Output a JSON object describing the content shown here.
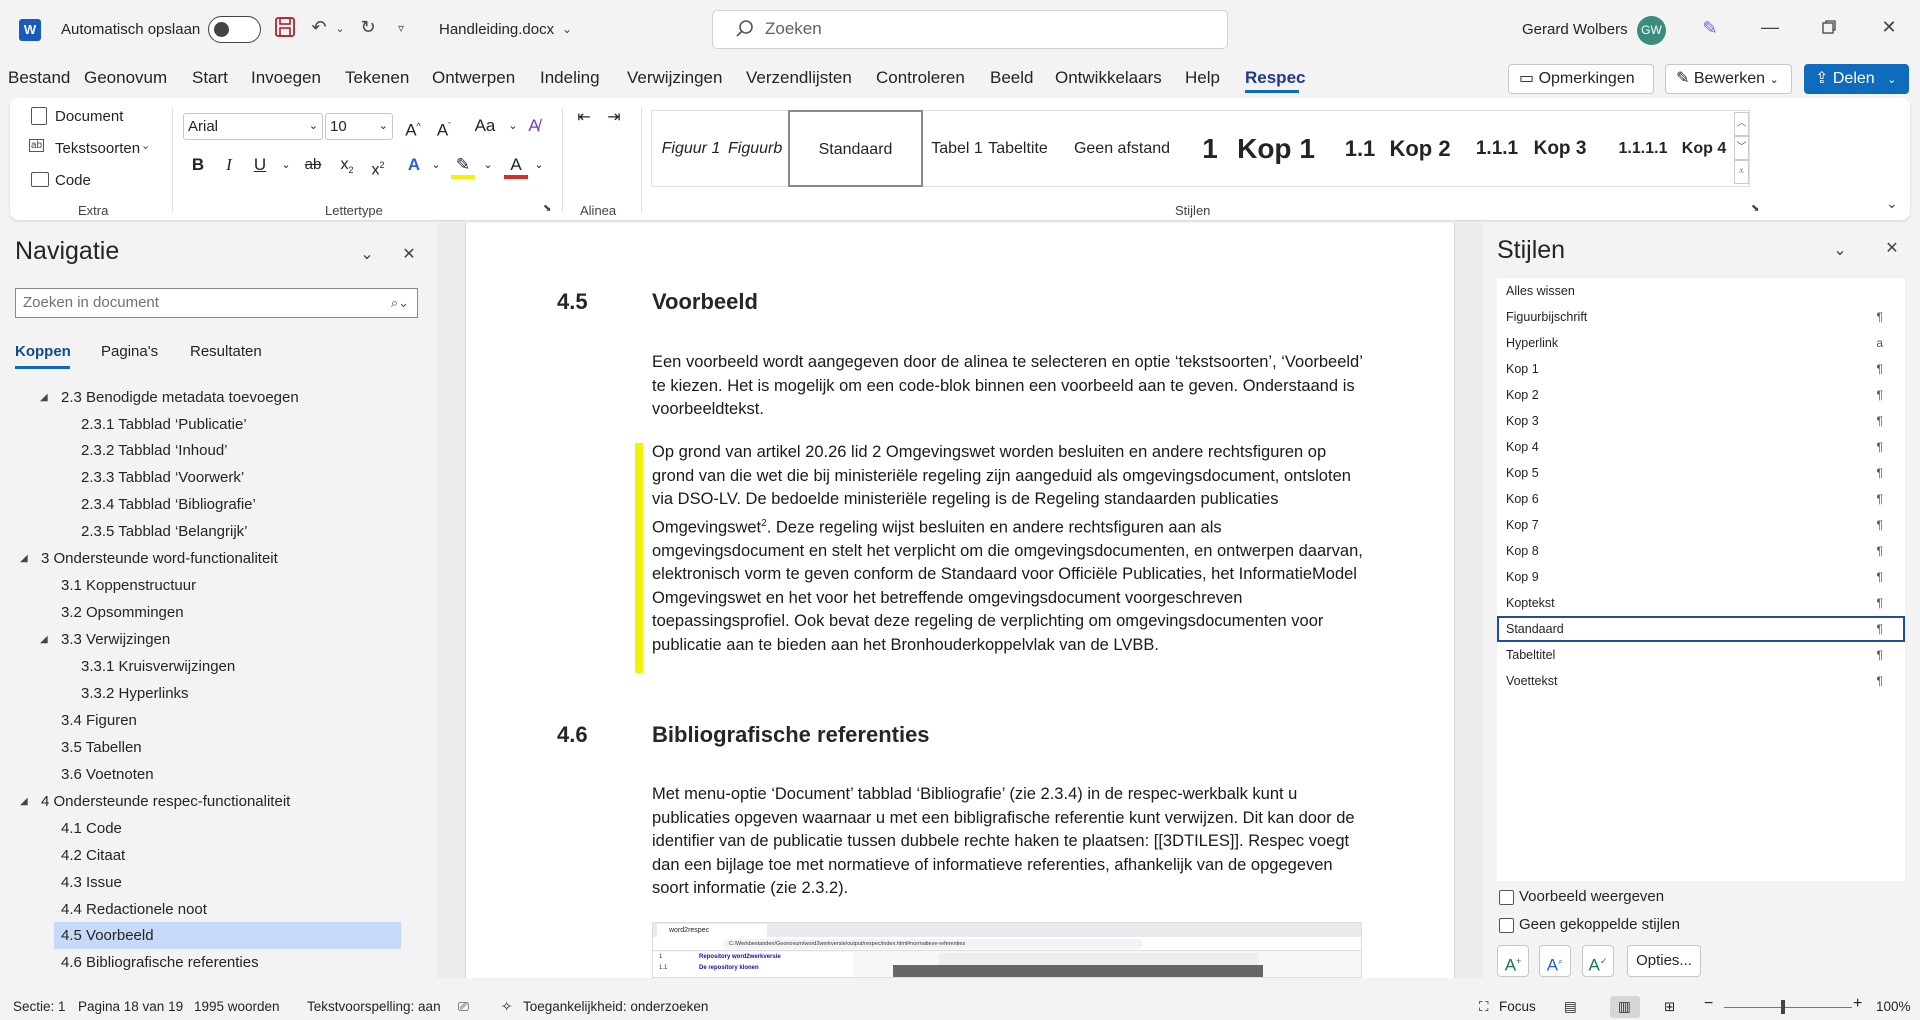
{
  "titlebar": {
    "autosave_label": "Automatisch opslaan",
    "filename": "Handleiding.docx",
    "search_placeholder": "Zoeken",
    "user_name": "Gerard Wolbers",
    "user_initials": "GW"
  },
  "menu": {
    "items": [
      "Bestand",
      "Geonovum",
      "Start",
      "Invoegen",
      "Tekenen",
      "Ontwerpen",
      "Indeling",
      "Verwijzingen",
      "Verzendlijsten",
      "Controleren",
      "Beeld",
      "Ontwikkelaars",
      "Help",
      "Respec"
    ],
    "active": "Respec",
    "opmerkingen": "Opmerkingen",
    "bewerken": "Bewerken",
    "delen": "Delen"
  },
  "ribbon": {
    "extra": {
      "document": "Document",
      "tekstsoorten": "Tekstsoorten",
      "code": "Code",
      "group_label": "Extra"
    },
    "font": {
      "family": "Arial",
      "size": "10",
      "group_label": "Lettertype"
    },
    "alinea": {
      "group_label": "Alinea"
    },
    "styles": {
      "group_label": "Stijlen",
      "items": [
        "Figuur 1",
        "Figuurb",
        "Standaard",
        "Tabel 1",
        "Tabeltite",
        "Geen afstand",
        "1",
        "Kop 1",
        "1.1",
        "Kop 2",
        "1.1.1",
        "Kop 3",
        "1.1.1.1",
        "Kop 4"
      ]
    }
  },
  "navigation": {
    "title": "Navigatie",
    "search_placeholder": "Zoeken in document",
    "tabs": [
      "Koppen",
      "Pagina's",
      "Resultaten"
    ],
    "items": [
      "2.3 Benodigde metadata toevoegen",
      "2.3.1 Tabblad ‘Publicatie’",
      "2.3.2 Tabblad ‘Inhoud’",
      "2.3.3 Tabblad ‘Voorwerk’",
      "2.3.4 Tabblad ‘Bibliografie’",
      "2.3.5 Tabblad ‘Belangrijk’",
      "3 Ondersteunde word-functionaliteit",
      "3.1 Koppenstructuur",
      "3.2 Opsommingen",
      "3.3 Verwijzingen",
      "3.3.1 Kruisverwijzingen",
      "3.3.2 Hyperlinks",
      "3.4 Figuren",
      "3.5 Tabellen",
      "3.6 Voetnoten",
      "4 Ondersteunde respec-functionaliteit",
      "4.1 Code",
      "4.2 Citaat",
      "4.3 Issue",
      "4.4 Redactionele noot",
      "4.5 Voorbeeld",
      "4.6 Bibliografische referenties"
    ],
    "selected": "4.5 Voorbeeld"
  },
  "document": {
    "h45_num": "4.5",
    "h45_text": "Voorbeeld",
    "p1": "Een voorbeeld wordt aangegeven door de alinea te selecteren en optie ‘tekstsoorten’, ‘Voorbeeld’ te kiezen. Het is mogelijk om een code-blok binnen een voorbeeld aan te geven. Onderstaand is voorbeeldtekst.",
    "p2a": "Op grond van artikel 20.26 lid 2 Omgevingswet worden besluiten en andere rechtsfiguren op grond van die wet die bij ministeriële regeling zijn aangeduid als omgevingsdocument, ontsloten via DSO-LV. De bedoelde ministeriële regeling is de Regeling standaarden publicaties Omgevingswet",
    "p2_sup": "2",
    "p2b": ". Deze regeling wijst besluiten en andere rechtsfiguren aan als omgevingsdocument en stelt het verplicht om die omgevingsdocumenten, en ontwerpen daarvan, elektronisch vorm te geven conform de Standaard voor Officiële Publicaties, het InformatieModel Omgevingswet en het voor het betreffende omgevingsdocument voorgeschreven toepassingsprofiel. Ook bevat deze regeling de verplichting om omgevingsdocumenten voor publicatie aan te bieden aan het Bronhouderkoppelvlak van de LVBB.",
    "h46_num": "4.6",
    "h46_text": "Bibliografische referenties",
    "p3": "Met menu-optie ‘Document’ tabblad ‘Bibliografie’ (zie 2.3.4) in de respec-werkbalk kunt u publicaties opgeven waarnaar u met een bibligrafische referentie kunt verwijzen. Dit kan door de identifier van de publicatie tussen dubbele rechte haken te plaatsen: [[3DTILES]]. Respec voegt dan een bijlage toe met normatieve of informatieve referenties, afhankelijk van de opgegeven soort informatie (zie 2.3.2).",
    "img_tab": "word2respec",
    "img_url": "C:/Werkbestanden/Geonovum/word2werkversie/output/respec/index.html#normatieve-referenties",
    "img_line1": "Repository word2werkversie",
    "img_line2": "De repository klonen",
    "img_num1": "1",
    "img_num2": "1.1"
  },
  "styles_pane": {
    "title": "Stijlen",
    "items": [
      {
        "name": "Alles wissen",
        "mark": ""
      },
      {
        "name": "Figuurbijschrift",
        "mark": "¶"
      },
      {
        "name": "Hyperlink",
        "mark": "a"
      },
      {
        "name": "Kop 1",
        "mark": "¶"
      },
      {
        "name": "Kop 2",
        "mark": "¶"
      },
      {
        "name": "Kop 3",
        "mark": "¶"
      },
      {
        "name": "Kop 4",
        "mark": "¶"
      },
      {
        "name": "Kop 5",
        "mark": "¶"
      },
      {
        "name": "Kop 6",
        "mark": "¶"
      },
      {
        "name": "Kop 7",
        "mark": "¶"
      },
      {
        "name": "Kop 8",
        "mark": "¶"
      },
      {
        "name": "Kop 9",
        "mark": "¶"
      },
      {
        "name": "Koptekst",
        "mark": "¶"
      },
      {
        "name": "Standaard",
        "mark": "¶"
      },
      {
        "name": "Tabeltitel",
        "mark": "¶"
      },
      {
        "name": "Voettekst",
        "mark": "¶"
      }
    ],
    "selected": "Standaard",
    "preview_label": "Voorbeeld weergeven",
    "linked_label": "Geen gekoppelde stijlen",
    "options_label": "Opties..."
  },
  "status": {
    "section": "Sectie: 1",
    "page": "Pagina 18 van 19",
    "words": "1995 woorden",
    "predict": "Tekstvoorspelling: aan",
    "accessibility": "Toegankelijkheid: onderzoeken",
    "focus": "Focus",
    "zoom": "100%"
  }
}
